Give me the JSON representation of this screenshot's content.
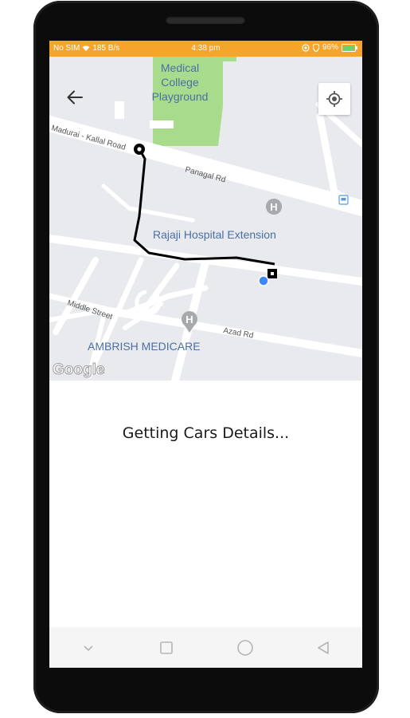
{
  "status_bar": {
    "carrier": "No SIM",
    "data_rate": "185 B/s",
    "time": "4:38 pm",
    "battery": "96%",
    "background_color": "#f6a42a"
  },
  "map": {
    "labels": {
      "place_medical_college": "Medical",
      "place_medical_college_2": "College",
      "place_playground": "Playground",
      "road_madurai": "Madurai - Kallal Road",
      "road_panagal": "Panagal Rd",
      "place_rajaji": "Rajaji Hospital Extension",
      "road_middle": "Middle Street",
      "road_azad": "Azad Rd",
      "place_ambrish": "AMBRISH MEDICARE",
      "google_logo": "Google"
    },
    "back_icon": "arrow-back-icon",
    "locate_icon": "my-location-icon",
    "route_color": "#000000",
    "user_location_color": "#4285f4",
    "park_color": "#a8dc8c",
    "land_color": "#e8eaed"
  },
  "main": {
    "loading_text": "Getting Cars Details..."
  },
  "nav_bar": {
    "icons": [
      "chevron-down-icon",
      "recent-apps-icon",
      "home-icon",
      "back-triangle-icon"
    ]
  }
}
